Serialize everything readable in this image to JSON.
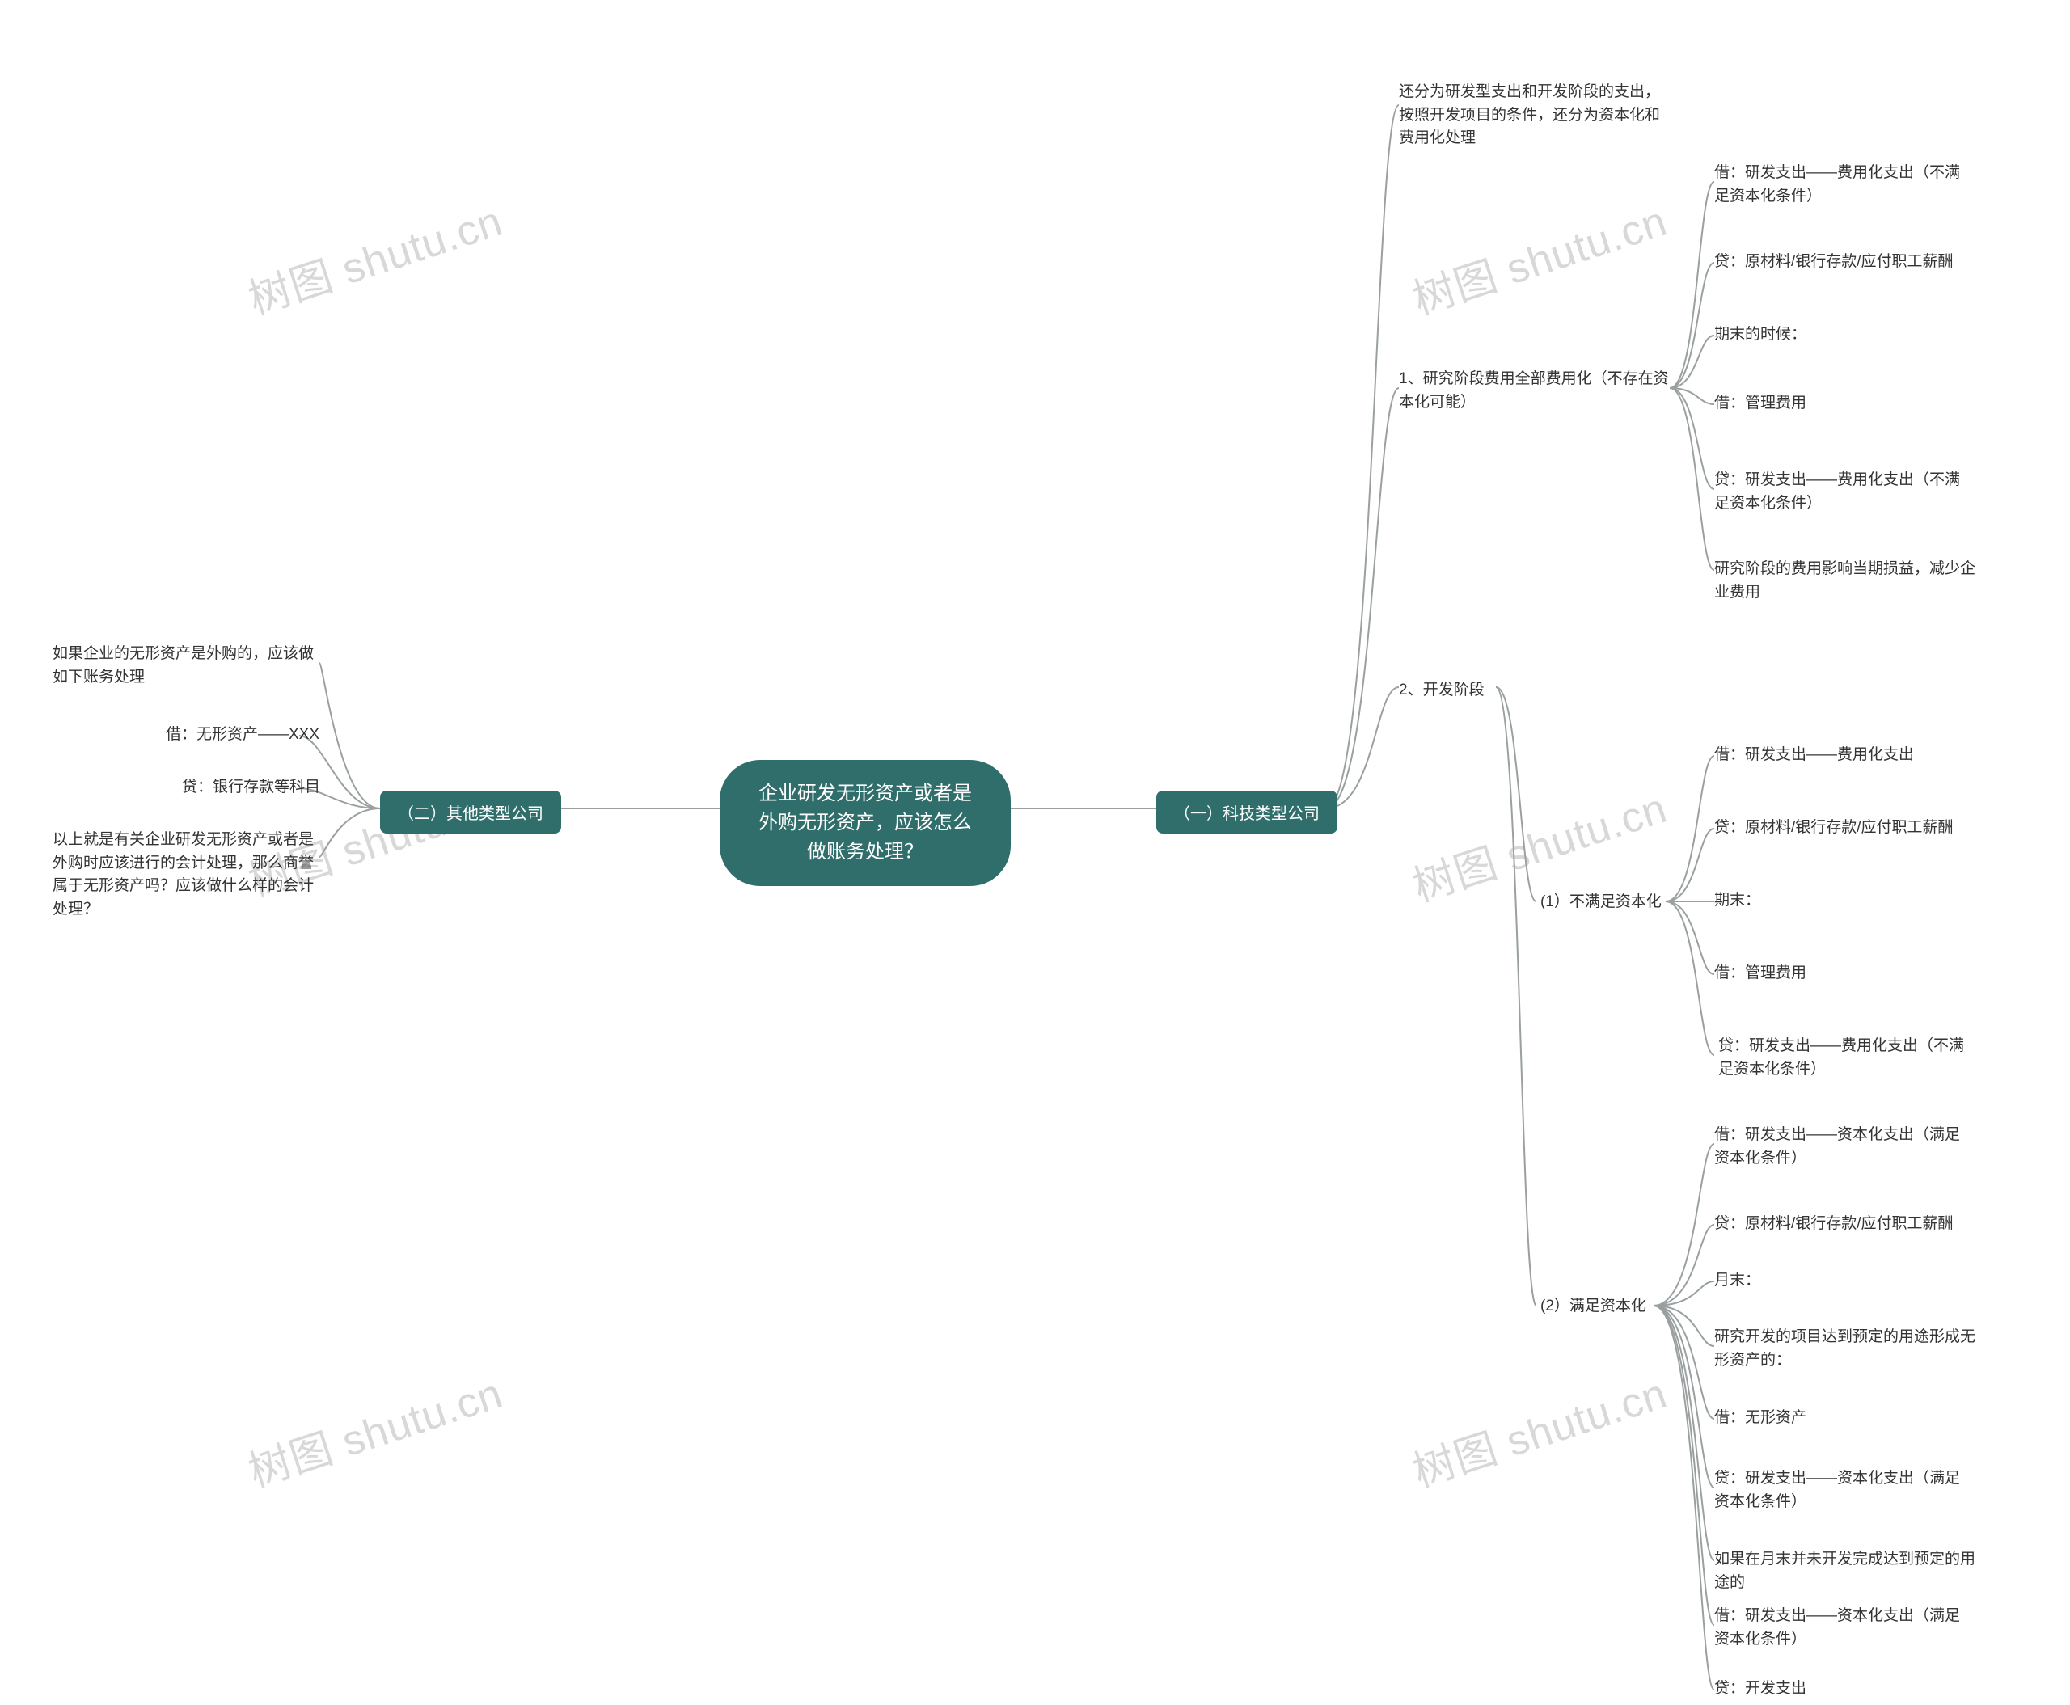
{
  "root": {
    "title_l1": "企业研发无形资产或者是",
    "title_l2": "外购无形资产，应该怎么",
    "title_l3": "做账务处理？"
  },
  "left": {
    "branch_label": "（二）其他类型公司",
    "items": [
      "如果企业的无形资产是外购的，应该做如下账务处理",
      "借：无形资产——XXX",
      "贷：银行存款等科目",
      "以上就是有关企业研发无形资产或者是外购时应该进行的会计处理，那么商誉属于无形资产吗？应该做什么样的会计处理？"
    ]
  },
  "right": {
    "branch_label": "（一）科技类型公司",
    "note_top": "还分为研发型支出和开发阶段的支出，按照开发项目的条件，还分为资本化和费用化处理",
    "section1": {
      "label": "1、研究阶段费用全部费用化（不存在资本化可能）",
      "items": [
        "借：研发支出——费用化支出（不满足资本化条件）",
        "贷：原材料/银行存款/应付职工薪酬",
        "期末的时候：",
        "借：管理费用",
        "贷：研发支出——费用化支出（不满足资本化条件）",
        "研究阶段的费用影响当期损益，减少企业费用"
      ]
    },
    "section2": {
      "label": "2、开发阶段",
      "sub1": {
        "label": "(1）不满足资本化",
        "items": [
          "借：研发支出——费用化支出",
          "贷：原材料/银行存款/应付职工薪酬",
          "期末：",
          "借：管理费用",
          "贷：研发支出——费用化支出（不满足资本化条件）"
        ]
      },
      "sub2": {
        "label": "(2）满足资本化",
        "items": [
          "借：研发支出——资本化支出（满足资本化条件）",
          "贷：原材料/银行存款/应付职工薪酬",
          "月末：",
          "研究开发的项目达到预定的用途形成无形资产的：",
          "借：无形资产",
          "贷：研发支出——资本化支出（满足资本化条件）",
          "如果在月末并未开发完成达到预定的用途的",
          "借：研发支出——资本化支出（满足资本化条件）",
          "贷：开发支出"
        ]
      }
    }
  },
  "watermark": "树图 shutu.cn"
}
